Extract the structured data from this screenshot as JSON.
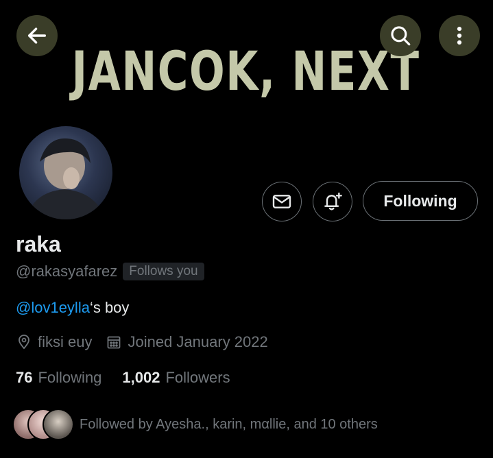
{
  "header": {
    "banner_text": "JANCOK, NEXT",
    "back_icon": "arrow-left-icon",
    "search_icon": "search-icon",
    "more_icon": "more-vertical-icon"
  },
  "profile": {
    "name": "raka",
    "handle": "@rakasyafarez",
    "follows_you_badge": "Follows you",
    "bio_mention": "@lov1eylla",
    "bio_text": "‘s boy",
    "location": "fiksi euy",
    "joined": "Joined January 2022",
    "following_count": "76",
    "following_label": "Following",
    "followers_count": "1,002",
    "followers_label": "Followers",
    "followed_by": "Followed by Ayesha., karin, mαllie, and 10 others"
  },
  "actions": {
    "message_icon": "mail-icon",
    "notify_icon": "bell-plus-icon",
    "following_button": "Following"
  },
  "colors": {
    "background": "#000000",
    "text_primary": "#e7e9ea",
    "text_secondary": "#71767b",
    "link": "#1d9bf0",
    "header_button_bg": "#3a3d28",
    "banner_text": "#c4c8a9"
  }
}
